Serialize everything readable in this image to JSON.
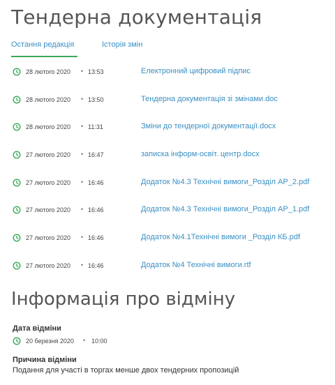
{
  "page": {
    "title": "Тендерна документація"
  },
  "tabs": [
    {
      "label": "Остання редакція",
      "active": true
    },
    {
      "label": "Історія змін",
      "active": false
    }
  ],
  "documents": [
    {
      "date": "28 лютого 2020",
      "sep": "•",
      "time": "13:53",
      "name": "Електронний цифровий підпис"
    },
    {
      "date": "28 лютого 2020",
      "sep": "•",
      "time": "13:50",
      "name": "Тендерна документація зі змінами.doc"
    },
    {
      "date": "28 лютого 2020",
      "sep": "•",
      "time": "11:31",
      "name": "Зміни до тендерної документації.docx"
    },
    {
      "date": "27 лютого 2020",
      "sep": "•",
      "time": "16:47",
      "name": "записка інформ-освіт. центр.docx"
    },
    {
      "date": "27 лютого 2020",
      "sep": "•",
      "time": "16:46",
      "name": "Додаток №4.3 Технічні вимоги_Розділ АР_2.pdf"
    },
    {
      "date": "27 лютого 2020",
      "sep": "•",
      "time": "16:46",
      "name": "Додаток №4.3 Технічні вимоги_Розділ АР_1.pdf"
    },
    {
      "date": "27 лютого 2020",
      "sep": "•",
      "time": "16:46",
      "name": "Додаток №4.1Технічні вимоги _Розділ КБ.pdf"
    },
    {
      "date": "27 лютого 2020",
      "sep": "•",
      "time": "16:46",
      "name": "Додаток №4 Технічні вимоги.rtf"
    }
  ],
  "cancellation": {
    "title": "Інформація про відміну",
    "date_label": "Дата відміни",
    "date": "20 березня 2020",
    "sep": "•",
    "time": "10:00",
    "reason_label": "Причина відміни",
    "reason": "Подання для участі в торгах менше двох тендерних пропозицій"
  },
  "colors": {
    "accent": "#3aaa5a",
    "link": "#3a8fc3",
    "heading": "#555555"
  }
}
